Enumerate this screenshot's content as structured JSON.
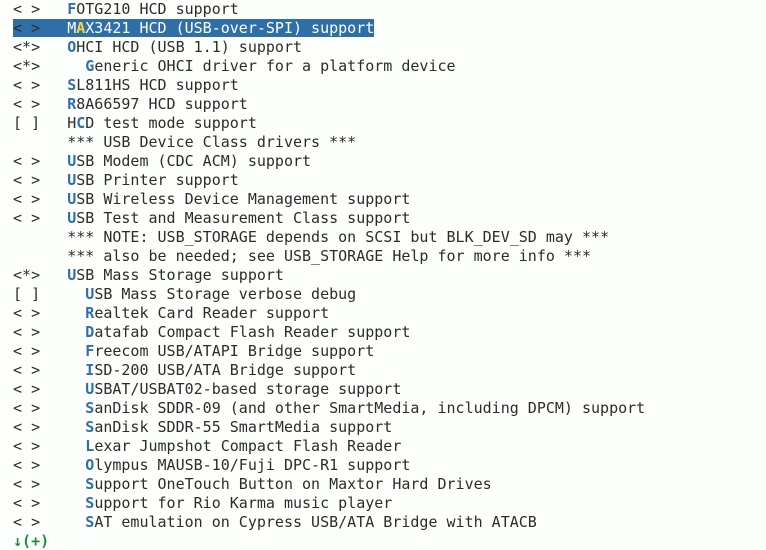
{
  "lines": [
    {
      "indent": 1,
      "state": "< >",
      "pad": 3,
      "hotIdx": 0,
      "text": "FOTG210 HCD support",
      "selected": false
    },
    {
      "indent": 1,
      "state": "< >",
      "pad": 3,
      "hotIdx": 1,
      "text": "MAX3421 HCD (USB-over-SPI) support",
      "selected": true
    },
    {
      "indent": 1,
      "state": "<*>",
      "pad": 3,
      "hotIdx": 0,
      "text": "OHCI HCD (USB 1.1) support",
      "selected": false
    },
    {
      "indent": 1,
      "state": "<*>",
      "pad": 5,
      "hotIdx": 0,
      "text": "Generic OHCI driver for a platform device",
      "selected": false
    },
    {
      "indent": 1,
      "state": "< >",
      "pad": 3,
      "hotIdx": 0,
      "text": "SL811HS HCD support",
      "selected": false
    },
    {
      "indent": 1,
      "state": "< >",
      "pad": 3,
      "hotIdx": 0,
      "text": "R8A66597 HCD support",
      "selected": false
    },
    {
      "indent": 1,
      "state": "[ ]",
      "pad": 3,
      "hotIdx": 1,
      "text": "HCD test mode support",
      "selected": false
    },
    {
      "indent": 1,
      "state": "   ",
      "pad": 3,
      "hotIdx": -1,
      "text": "*** USB Device Class drivers ***",
      "selected": false
    },
    {
      "indent": 1,
      "state": "< >",
      "pad": 3,
      "hotIdx": 0,
      "text": "USB Modem (CDC ACM) support",
      "selected": false
    },
    {
      "indent": 1,
      "state": "< >",
      "pad": 3,
      "hotIdx": 0,
      "text": "USB Printer support",
      "selected": false
    },
    {
      "indent": 1,
      "state": "< >",
      "pad": 3,
      "hotIdx": 0,
      "text": "USB Wireless Device Management support",
      "selected": false
    },
    {
      "indent": 1,
      "state": "< >",
      "pad": 3,
      "hotIdx": 0,
      "text": "USB Test and Measurement Class support",
      "selected": false
    },
    {
      "indent": 1,
      "state": "   ",
      "pad": 3,
      "hotIdx": -1,
      "text": "*** NOTE: USB_STORAGE depends on SCSI but BLK_DEV_SD may ***",
      "selected": false
    },
    {
      "indent": 1,
      "state": "   ",
      "pad": 3,
      "hotIdx": -1,
      "text": "*** also be needed; see USB_STORAGE Help for more info ***",
      "selected": false
    },
    {
      "indent": 1,
      "state": "<*>",
      "pad": 3,
      "hotIdx": 0,
      "text": "USB Mass Storage support",
      "selected": false
    },
    {
      "indent": 1,
      "state": "[ ]",
      "pad": 5,
      "hotIdx": 0,
      "text": "USB Mass Storage verbose debug",
      "selected": false
    },
    {
      "indent": 1,
      "state": "< >",
      "pad": 5,
      "hotIdx": 0,
      "text": "Realtek Card Reader support",
      "selected": false
    },
    {
      "indent": 1,
      "state": "< >",
      "pad": 5,
      "hotIdx": 0,
      "text": "Datafab Compact Flash Reader support",
      "selected": false
    },
    {
      "indent": 1,
      "state": "< >",
      "pad": 5,
      "hotIdx": 0,
      "text": "Freecom USB/ATAPI Bridge support",
      "selected": false
    },
    {
      "indent": 1,
      "state": "< >",
      "pad": 5,
      "hotIdx": 0,
      "text": "ISD-200 USB/ATA Bridge support",
      "selected": false
    },
    {
      "indent": 1,
      "state": "< >",
      "pad": 5,
      "hotIdx": 0,
      "text": "USBAT/USBAT02-based storage support",
      "selected": false
    },
    {
      "indent": 1,
      "state": "< >",
      "pad": 5,
      "hotIdx": 0,
      "text": "SanDisk SDDR-09 (and other SmartMedia, including DPCM) support",
      "selected": false
    },
    {
      "indent": 1,
      "state": "< >",
      "pad": 5,
      "hotIdx": 0,
      "text": "SanDisk SDDR-55 SmartMedia support",
      "selected": false
    },
    {
      "indent": 1,
      "state": "< >",
      "pad": 5,
      "hotIdx": 0,
      "text": "Lexar Jumpshot Compact Flash Reader",
      "selected": false
    },
    {
      "indent": 1,
      "state": "< >",
      "pad": 5,
      "hotIdx": 0,
      "text": "Olympus MAUSB-10/Fuji DPC-R1 support",
      "selected": false
    },
    {
      "indent": 1,
      "state": "< >",
      "pad": 5,
      "hotIdx": 0,
      "text": "Support OneTouch Button on Maxtor Hard Drives",
      "selected": false
    },
    {
      "indent": 1,
      "state": "< >",
      "pad": 5,
      "hotIdx": 0,
      "text": "Support for Rio Karma music player",
      "selected": false
    },
    {
      "indent": 1,
      "state": "< >",
      "pad": 5,
      "hotIdx": 0,
      "text": "SAT emulation on Cypress USB/ATA Bridge with ATACB",
      "selected": false
    }
  ],
  "footer": {
    "arrow": "↓",
    "more": "(+)"
  }
}
